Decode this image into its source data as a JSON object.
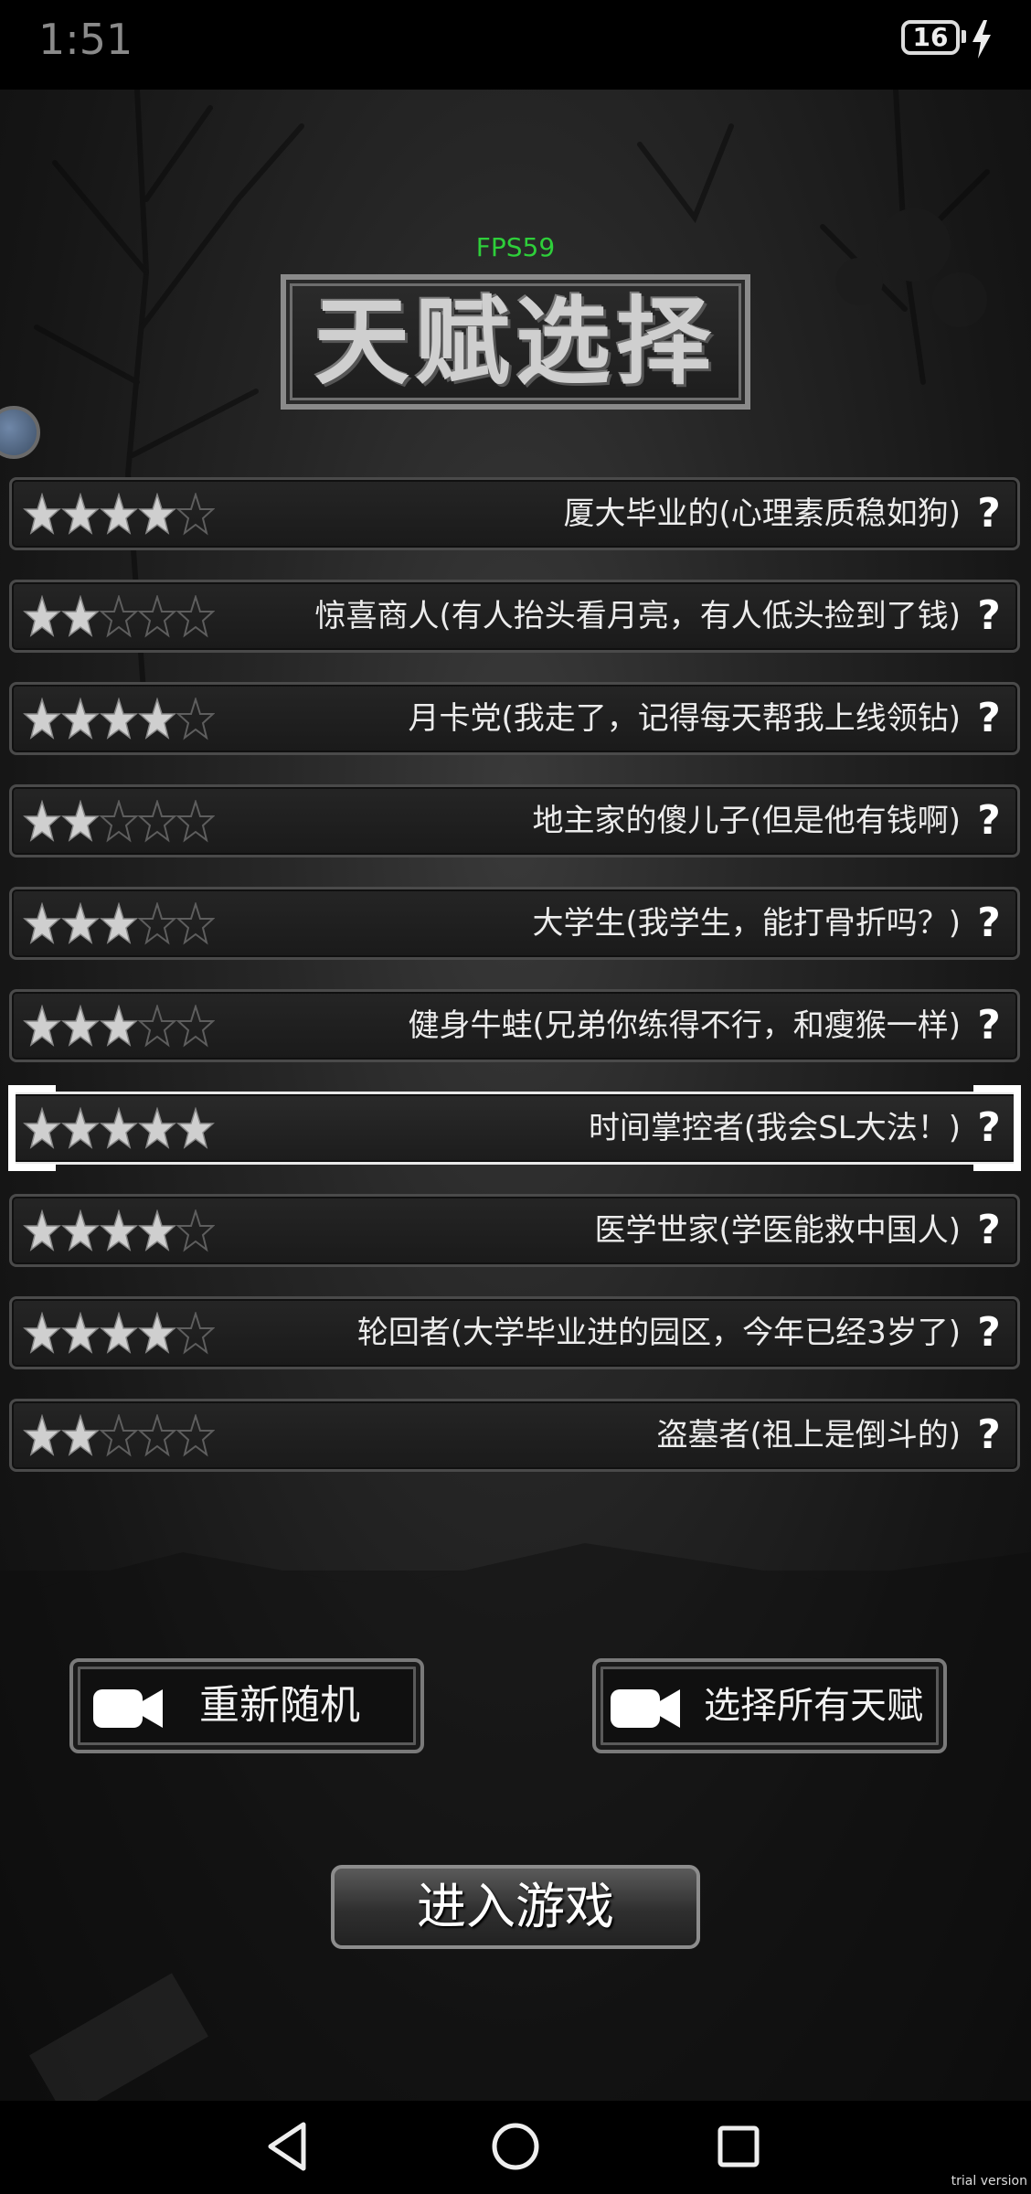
{
  "status_bar": {
    "time": "1:51",
    "battery_level": "16"
  },
  "fps_label": "FPS59",
  "title": "天赋选择",
  "talents": [
    {
      "stars": 4,
      "name": "厦大毕业的(心理素质稳如狗)",
      "selected": false
    },
    {
      "stars": 2,
      "name": "惊喜商人(有人抬头看月亮，有人低头捡到了钱)",
      "selected": false
    },
    {
      "stars": 4,
      "name": "月卡党(我走了，记得每天帮我上线领钻)",
      "selected": false
    },
    {
      "stars": 2,
      "name": "地主家的傻儿子(但是他有钱啊)",
      "selected": false
    },
    {
      "stars": 3,
      "name": "大学生(我学生，能打骨折吗？)",
      "selected": false
    },
    {
      "stars": 3,
      "name": "健身牛蛙(兄弟你练得不行，和瘦猴一样)",
      "selected": false
    },
    {
      "stars": 5,
      "name": "时间掌控者(我会SL大法！)",
      "selected": true
    },
    {
      "stars": 4,
      "name": "医学世家(学医能救中国人)",
      "selected": false
    },
    {
      "stars": 4,
      "name": "轮回者(大学毕业进的园区，今年已经3岁了)",
      "selected": false
    },
    {
      "stars": 2,
      "name": "盗墓者(祖上是倒斗的)",
      "selected": false
    }
  ],
  "help_glyph": "?",
  "buttons": {
    "reroll_label": "重新随机",
    "select_all_label": "选择所有天赋",
    "start_label": "进入游戏"
  },
  "icons": {
    "reroll": "video-camera-icon",
    "select_all": "video-camera-icon",
    "nav_back": "triangle-back-icon",
    "nav_home": "circle-home-icon",
    "nav_recents": "square-recents-icon"
  },
  "watermark": "trial version"
}
